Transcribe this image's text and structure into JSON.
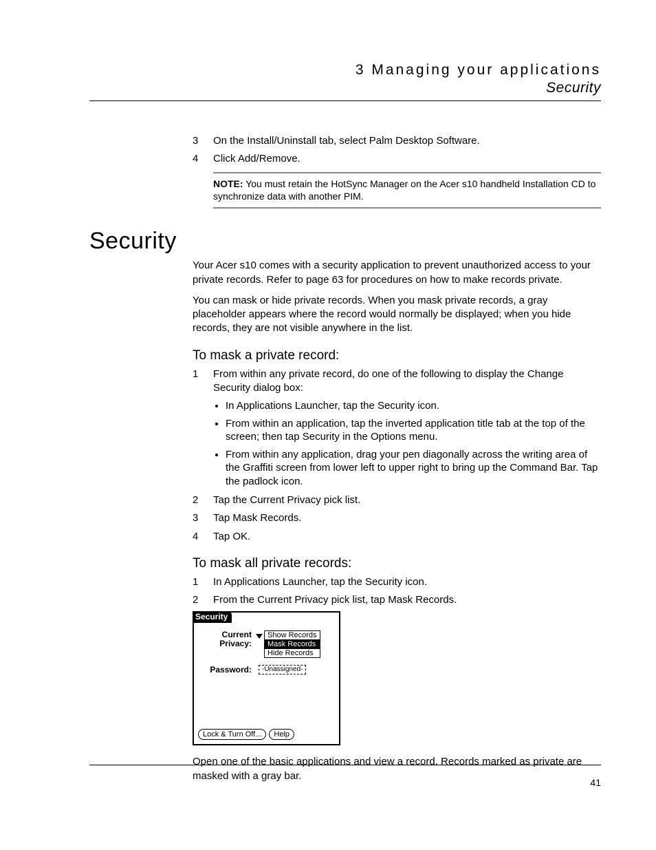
{
  "header": {
    "chapter": "3 Managing your applications",
    "section": "Security"
  },
  "steps_a": [
    {
      "n": "3",
      "t": "On the Install/Uninstall tab, select Palm Desktop Software."
    },
    {
      "n": "4",
      "t": "Click Add/Remove."
    }
  ],
  "note": {
    "label": "NOTE:",
    "text": "You must retain the HotSync Manager on the Acer s10 handheld Installation CD to synchronize data with another PIM."
  },
  "h1": "Security",
  "para1": "Your Acer s10 comes with a security application to prevent unauthorized access to your private records. Refer to page 63 for procedures on how to make records private.",
  "para2": "You can mask or hide private records. When you mask private records, a gray placeholder appears where the record would normally be displayed; when you hide records, they are not visible anywhere in the list.",
  "sub1": "To mask a private record:",
  "steps_b": [
    {
      "n": "1",
      "t": "From within any private record, do one of the following to display the Change Security dialog box:"
    }
  ],
  "bullets": [
    "In Applications Launcher, tap the Security icon.",
    "From within an application, tap the inverted application title tab at the top of the screen; then tap Security in the Options menu.",
    "From within any application, drag your pen diagonally across the writing area of the Graffiti screen from lower left to upper right to bring up the Command Bar. Tap the padlock icon."
  ],
  "steps_c": [
    {
      "n": "2",
      "t": "Tap the Current Privacy pick list."
    },
    {
      "n": "3",
      "t": "Tap Mask Records."
    },
    {
      "n": "4",
      "t": "Tap OK."
    }
  ],
  "sub2": "To mask all private records:",
  "steps_d": [
    {
      "n": "1",
      "t": "In Applications Launcher, tap the Security icon."
    },
    {
      "n": "2",
      "t": "From the Current Privacy pick list, tap Mask Records."
    }
  ],
  "palm": {
    "title": "Security",
    "label_current": "Current",
    "label_privacy": "Privacy:",
    "options": {
      "show": "Show Records",
      "mask": "Mask Records",
      "hide": "Hide Records"
    },
    "label_password": "Password:",
    "pw_value": "-Unassigned-",
    "btn_lock": "Lock & Turn Off...",
    "btn_help": "Help"
  },
  "para3": "Open one of the basic applications and view a record. Records marked as private are masked with a gray bar.",
  "page_number": "41"
}
